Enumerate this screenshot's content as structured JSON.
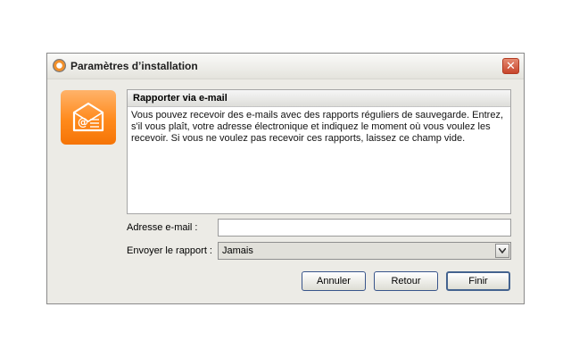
{
  "window": {
    "title": "Paramètres d’installation",
    "icons": {
      "app": "app-logo-icon",
      "close": "close-icon",
      "tile": "email-envelope-icon"
    },
    "close_glyph": "✕"
  },
  "info": {
    "title": "Rapporter via e-mail",
    "text": "Vous pouvez recevoir des e-mails avec des rapports réguliers de sauvegarde. Entrez, s'il vous plaît, votre adresse électronique et indiquez le moment où vous voulez les recevoir. Si vous ne voulez pas recevoir ces rapports, laissez ce champ vide."
  },
  "form": {
    "email_label": "Adresse e-mail :",
    "email_value": "",
    "email_placeholder": "",
    "send_label": "Envoyer le rapport :",
    "send_value": "Jamais"
  },
  "buttons": {
    "cancel": "Annuler",
    "back": "Retour",
    "finish": "Finir"
  },
  "colors": {
    "accent": "#ff8a1c",
    "close": "#c7452b",
    "button_border": "#39558b"
  }
}
